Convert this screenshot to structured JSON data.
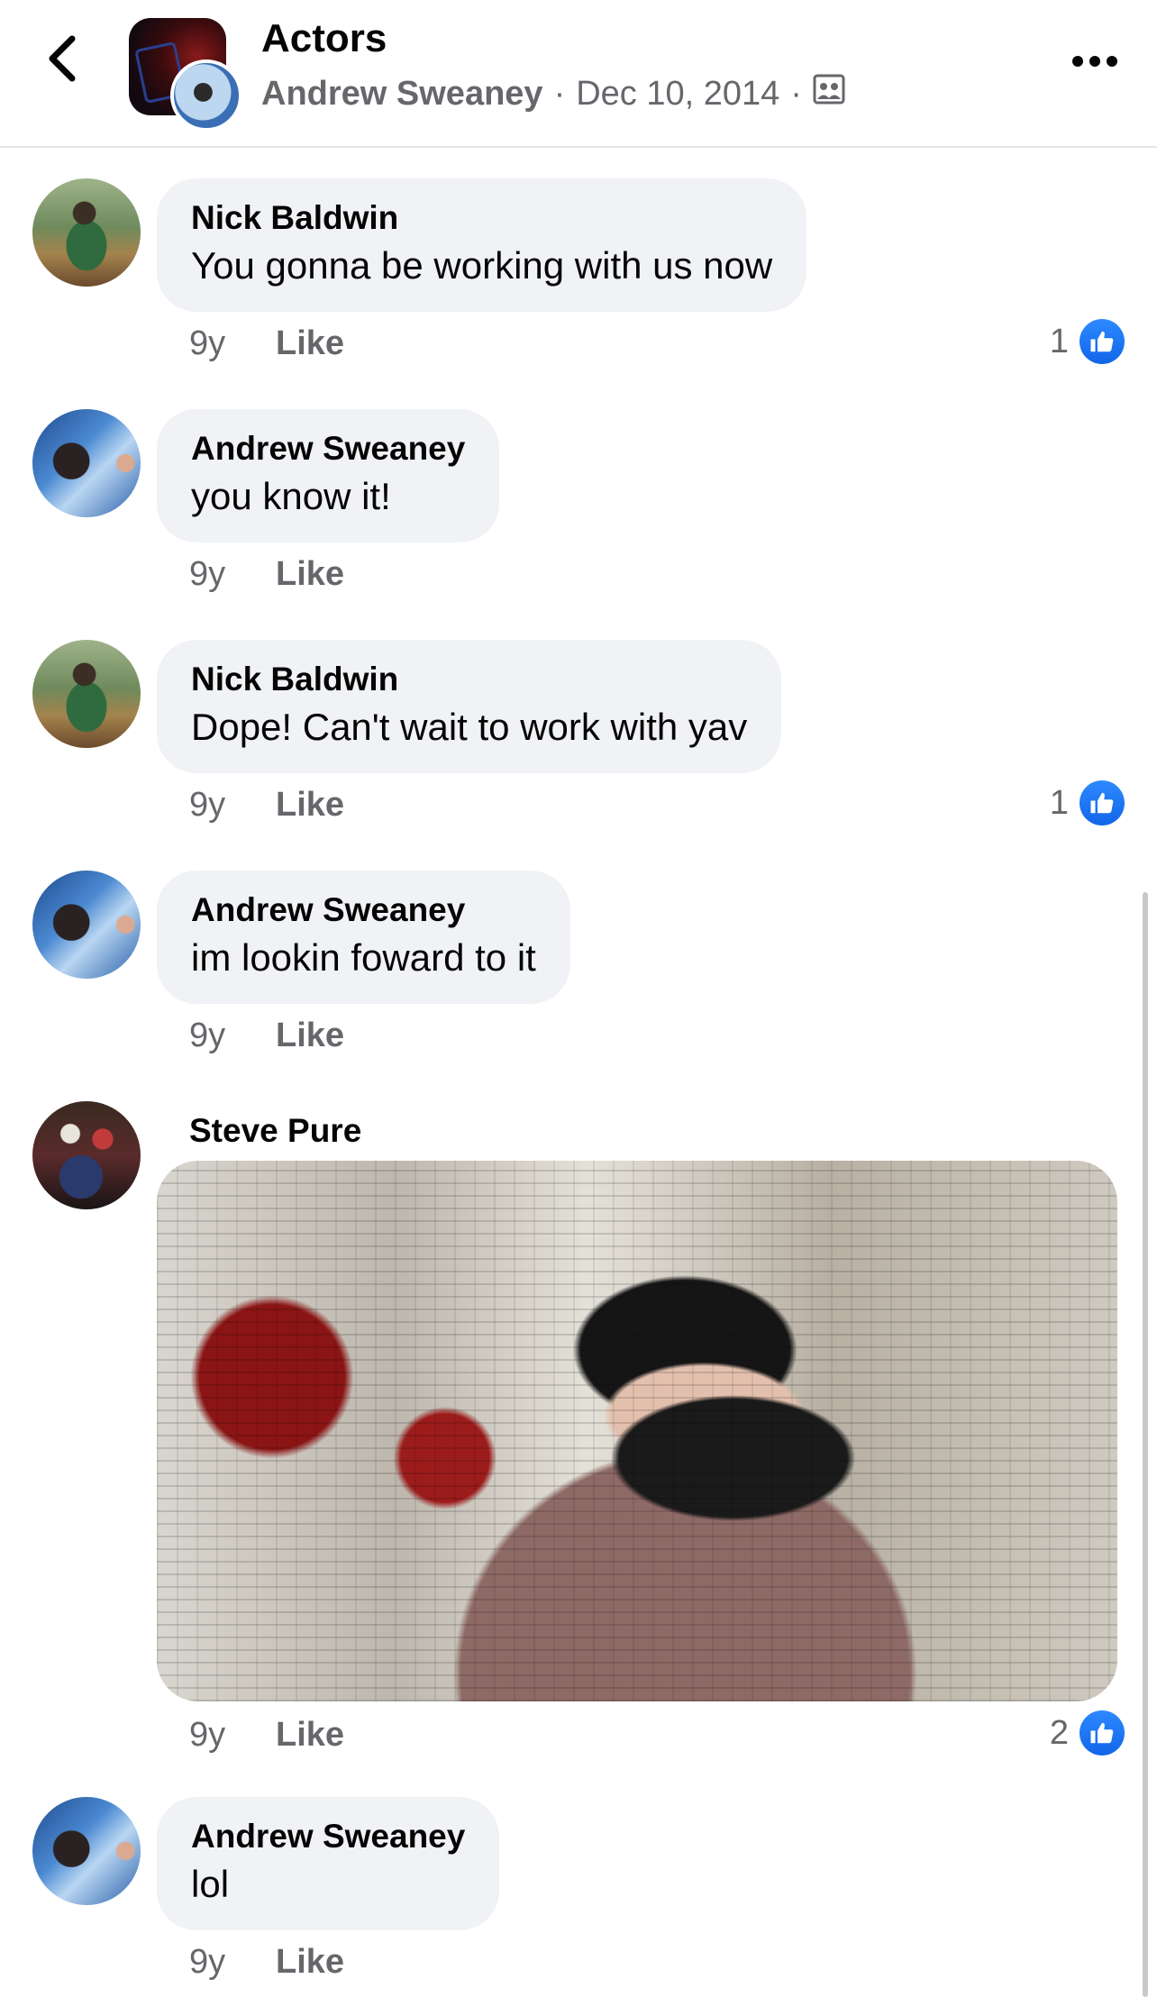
{
  "header": {
    "title": "Actors",
    "author": "Andrew Sweaney",
    "separator1": "·",
    "date": "Dec 10, 2014",
    "separator2": "·",
    "privacy_icon": "group-privacy-icon"
  },
  "comments": [
    {
      "author": "Nick Baldwin",
      "text": "You gonna be working with us now",
      "time": "9y",
      "like": "Like",
      "reaction_count": "1"
    },
    {
      "author": "Andrew Sweaney",
      "text": "you know it!",
      "time": "9y",
      "like": "Like"
    },
    {
      "author": "Nick Baldwin",
      "text": "Dope! Can't wait to work with yav",
      "time": "9y",
      "like": "Like",
      "reaction_count": "1"
    },
    {
      "author": "Andrew Sweaney",
      "text": "im lookin foward to it",
      "time": "9y",
      "like": "Like"
    },
    {
      "author": "Steve Pure",
      "image": "photo-comment",
      "time": "9y",
      "like": "Like",
      "reaction_count": "2"
    },
    {
      "author": "Andrew Sweaney",
      "text": "lol",
      "time": "9y",
      "like": "Like"
    }
  ],
  "colors": {
    "bubble": "#f0f2f5",
    "muted": "#65676b",
    "like_blue": "#1877f2"
  }
}
